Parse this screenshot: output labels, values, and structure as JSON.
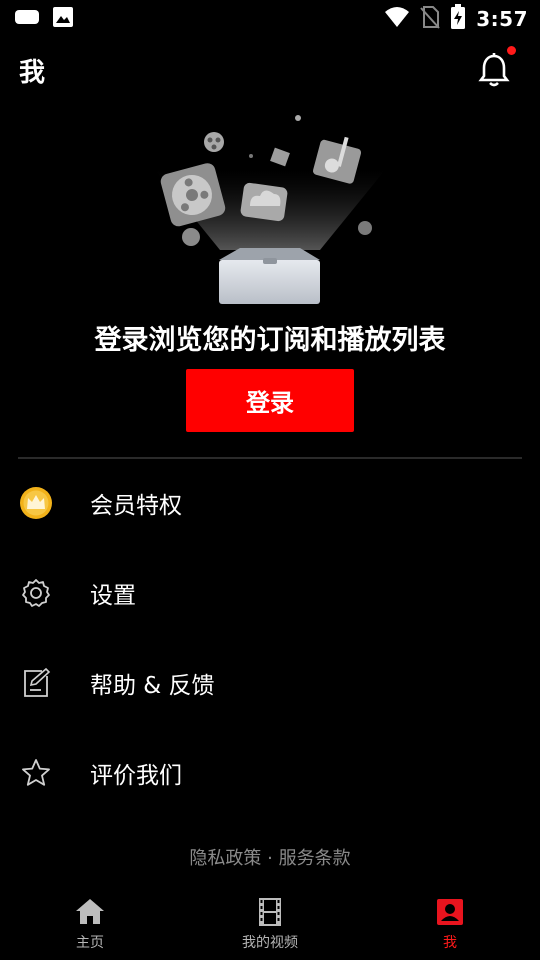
{
  "status_bar": {
    "time": "3:57",
    "icons": [
      "keyboard-icon",
      "image-icon",
      "wifi-icon",
      "no-sim-icon",
      "battery-charging-icon"
    ]
  },
  "header": {
    "title": "我",
    "notification_icon": "bell-icon",
    "notification_dot_color": "#ff1a1a"
  },
  "hero": {
    "illustration": "open-box-with-media-icons",
    "prompt": "登录浏览您的订阅和播放列表",
    "login_button": "登录"
  },
  "menu": [
    {
      "icon": "crown-icon",
      "label": "会员特权"
    },
    {
      "icon": "gear-icon",
      "label": "设置"
    },
    {
      "icon": "feedback-icon",
      "label": "帮助 & 反馈"
    },
    {
      "icon": "star-icon",
      "label": "评价我们"
    }
  ],
  "footer": {
    "privacy": "隐私政策",
    "separator": "·",
    "terms": "服务条款"
  },
  "bottom_nav": [
    {
      "icon": "home-icon",
      "label": "主页",
      "active": false
    },
    {
      "icon": "film-icon",
      "label": "我的视频",
      "active": false
    },
    {
      "icon": "profile-icon",
      "label": "我",
      "active": true
    }
  ],
  "colors": {
    "accent": "#ff0000",
    "background": "#000000",
    "footer_text": "#8a8a8a"
  }
}
